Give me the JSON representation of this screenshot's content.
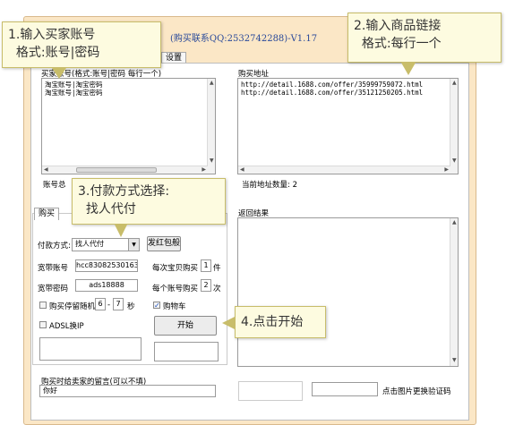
{
  "window": {
    "title": "(购买联系QQ:2532742288)-V1.17",
    "tabs": [
      "设置"
    ]
  },
  "accounts": {
    "header": "买家账号(格式:账号|密码 每行一个)",
    "lines": "淘宝账号|淘宝密码\n淘宝账号|淘宝密码",
    "scroll_label": "|||",
    "count_label": "账号总"
  },
  "urls": {
    "header": "购买地址",
    "lines": "http://detail.1688.com/offer/35999759072.html\nhttp://detail.1688.com/offer/35121250205.html",
    "count_label": "当前地址数量:",
    "count_value": "2"
  },
  "purchase": {
    "tab_label": "购买",
    "payment_label": "付款方式:",
    "payment_value": "找人代付",
    "red_packet_button": "发红包般",
    "broadband_account_label": "宽带账号",
    "broadband_account_value": "hcc83082530163",
    "broadband_password_label": "宽带密码",
    "broadband_password_value": "ads18888",
    "per_item_label": "每次宝贝购买",
    "per_item_value": "1",
    "per_item_unit": "件",
    "per_account_label": "每个账号购买",
    "per_account_value": "2",
    "per_account_unit": "次",
    "pause_label": "购买停留随机",
    "pause_min": "6",
    "pause_dash": "-",
    "pause_max": "7",
    "pause_unit": "秒",
    "cart_label": "购物车",
    "cart_checked": true,
    "adsl_label": "ADSL换IP",
    "start_button": "开始"
  },
  "results": {
    "header": "返回结果"
  },
  "message": {
    "label": "购买时给卖家的留言(可以不填)",
    "value": "你好"
  },
  "captcha": {
    "link": "点击图片更换验证码"
  },
  "callouts": {
    "c1": "1.输入买家账号\n  格式:账号|密码",
    "c2": "2.输入商品链接\n  格式:每行一个",
    "c3": "3.付款方式选择:\n  找人代付",
    "c4": "4.点击开始"
  },
  "colors": {
    "window_bg": "#fbe7c6",
    "callout_bg": "#fdfbe0",
    "title_text": "#2a4a9a"
  }
}
